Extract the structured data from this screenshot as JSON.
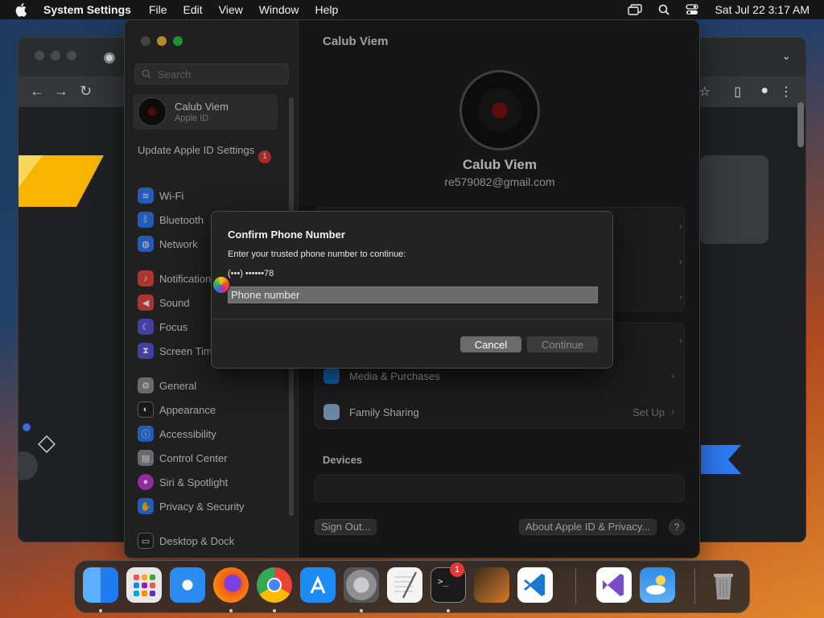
{
  "menubar": {
    "app_name": "System Settings",
    "items": [
      "File",
      "Edit",
      "View",
      "Window",
      "Help"
    ],
    "datetime": "Sat Jul 22  3:17 AM"
  },
  "sidebar": {
    "search_placeholder": "Search",
    "account": {
      "name": "Calub Viem",
      "subtitle": "Apple ID"
    },
    "update": {
      "label": "Update Apple ID Settings",
      "badge": "1"
    },
    "items": [
      {
        "label": "Wi-Fi",
        "icon": "wifi-icon",
        "color": "#2f7bf5"
      },
      {
        "label": "Bluetooth",
        "icon": "bluetooth-icon",
        "color": "#2f7bf5"
      },
      {
        "label": "Network",
        "icon": "globe-icon",
        "color": "#2f7bf5"
      },
      {
        "label": "Notifications",
        "icon": "bell-icon",
        "color": "#e5483d"
      },
      {
        "label": "Sound",
        "icon": "speaker-icon",
        "color": "#e5483d"
      },
      {
        "label": "Focus",
        "icon": "moon-icon",
        "color": "#5e55d8"
      },
      {
        "label": "Screen Time",
        "icon": "hourglass-icon",
        "color": "#5e55d8"
      },
      {
        "label": "General",
        "icon": "gear-icon",
        "color": "#8e8e93"
      },
      {
        "label": "Appearance",
        "icon": "appearance-icon",
        "color": "#222222"
      },
      {
        "label": "Accessibility",
        "icon": "accessibility-icon",
        "color": "#2f7bf5"
      },
      {
        "label": "Control Center",
        "icon": "control-center-icon",
        "color": "#8e8e93"
      },
      {
        "label": "Siri & Spotlight",
        "icon": "siri-icon",
        "color": "#c03bd1"
      },
      {
        "label": "Privacy & Security",
        "icon": "hand-icon",
        "color": "#2f7bf5"
      },
      {
        "label": "Desktop & Dock",
        "icon": "dock-icon",
        "color": "#222222"
      }
    ]
  },
  "main": {
    "title": "Calub Viem",
    "profile_name": "Calub Viem",
    "email": "re579082@gmail.com",
    "rows": [
      {
        "label": "Media & Purchases",
        "value": ""
      },
      {
        "label": "Family Sharing",
        "value": "Set Up"
      }
    ],
    "devices_label": "Devices",
    "sign_out": "Sign Out...",
    "about": "About Apple ID & Privacy...",
    "help": "?"
  },
  "dialog": {
    "title": "Confirm Phone Number",
    "description": "Enter your trusted phone number to continue:",
    "masked_number": "(•••) ••••••78",
    "input_placeholder": "Phone number",
    "cancel": "Cancel",
    "continue": "Continue"
  },
  "dock": {
    "apps": [
      {
        "name": "finder-icon",
        "color": "#1e7cf0"
      },
      {
        "name": "launchpad-icon",
        "color": "#e8e8e8"
      },
      {
        "name": "safari-icon",
        "color": "#2a8cf0"
      },
      {
        "name": "firefox-icon",
        "color": "#f2571d"
      },
      {
        "name": "chrome-icon",
        "color": "#34a853"
      },
      {
        "name": "app-store-icon",
        "color": "#1c8cf4"
      },
      {
        "name": "system-settings-icon",
        "color": "#8e8e93"
      },
      {
        "name": "textedit-icon",
        "color": "#f4f4f4"
      },
      {
        "name": "terminal-icon",
        "color": "#1a1a1a"
      },
      {
        "name": "garageband-icon",
        "color": "#d57a2a"
      },
      {
        "name": "vscode-icon",
        "color": "#1b77d0"
      },
      {
        "name": "visual-studio-icon",
        "color": "#7b4ac7"
      },
      {
        "name": "weather-icon",
        "color": "#2e8be8"
      },
      {
        "name": "trash-icon",
        "color": "#9a9a9a"
      }
    ],
    "settings_badge": "1"
  }
}
